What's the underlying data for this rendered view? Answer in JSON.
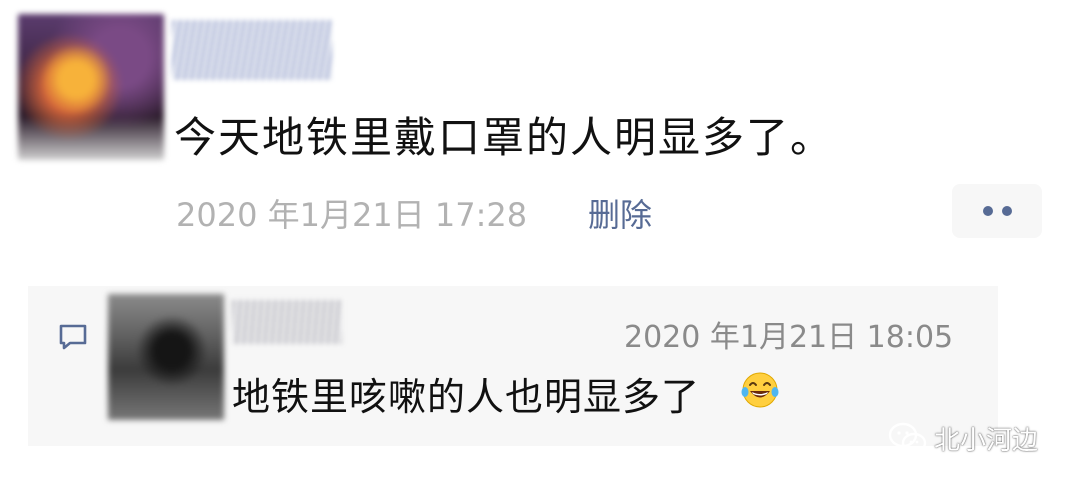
{
  "post": {
    "text": "今天地铁里戴口罩的人明显多了。",
    "timestamp": "2020 年1月21日 17:28",
    "delete_label": "删除",
    "more_icon": "more-dots-icon"
  },
  "comment": {
    "timestamp": "2020 年1月21日 18:05",
    "text": "地铁里咳嗽的人也明显多了",
    "emoji": "laughing-with-tears-emoji",
    "icon": "comment-bubble-icon"
  },
  "watermark": {
    "text": "北小河边",
    "icon": "wechat-icon"
  },
  "colors": {
    "link": "#576b95",
    "timestamp": "#b2b2b2",
    "comment_bg": "#f7f7f7"
  }
}
